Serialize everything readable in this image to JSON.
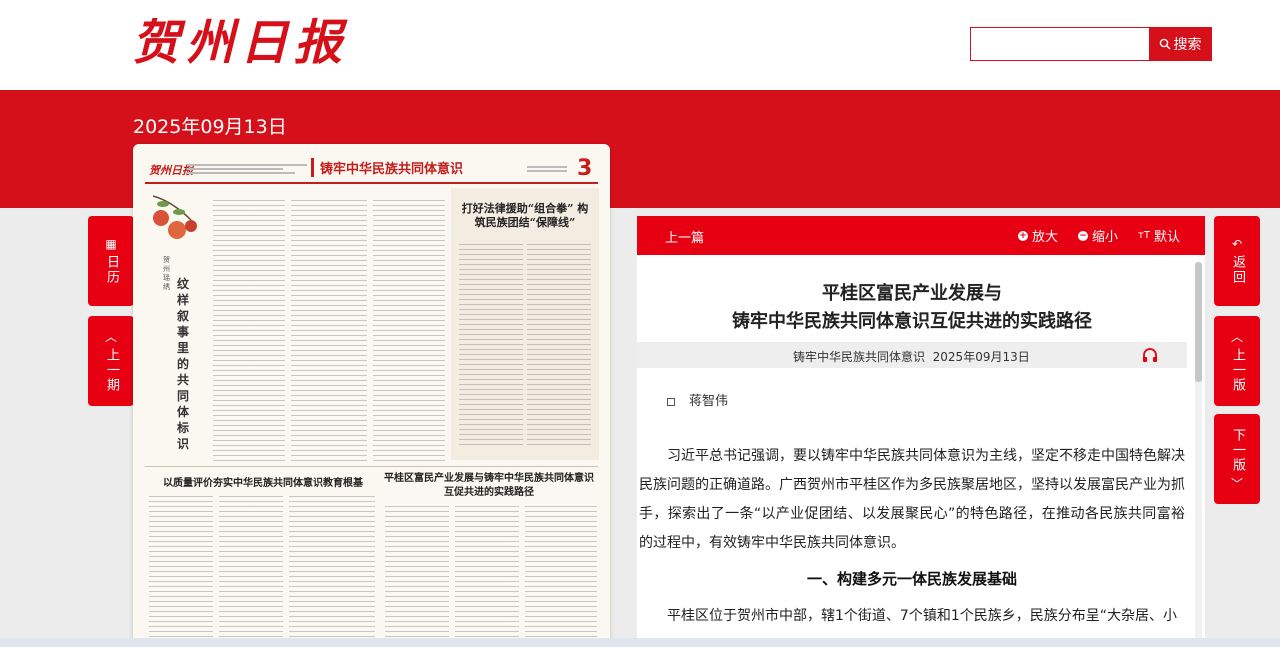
{
  "site": {
    "logo_text": "贺州日报"
  },
  "search": {
    "placeholder": "",
    "button_label": "搜索"
  },
  "issue_date": "2025年09月13日",
  "left_nav": {
    "calendar_label": "日历",
    "prev_issue_label": "上一期"
  },
  "right_nav": {
    "back_label": "返回",
    "prev_page_label": "上一版",
    "next_page_label": "下一版"
  },
  "newspaper_page": {
    "masthead": "贺州日报",
    "section_title": "铸牢中华民族共同体意识",
    "page_number": "3",
    "column_name": "贺州瑶绣",
    "feature_title": "纹样叙事里的共同体标识",
    "boxed_title": "打好法律援助“组合拳” 构筑民族团结“保障线”",
    "article_left_title": "以质量评价夯实中华民族共同体意识教育根基",
    "article_right_title": "平桂区富民产业发展与铸牢中华民族共同体意识互促共进的实践路径"
  },
  "article": {
    "toolbar": {
      "prev_label": "上一篇",
      "zoom_in_label": "放大",
      "zoom_out_label": "缩小",
      "default_label": "默认"
    },
    "title_line1": "平桂区富民产业发展与",
    "title_line2": "铸牢中华民族共同体意识互促共进的实践路径",
    "section_name": "铸牢中华民族共同体意识",
    "date": "2025年09月13日",
    "author": "蒋智伟",
    "paragraph1": "习近平总书记强调，要以铸牢中华民族共同体意识为主线，坚定不移走中国特色解决民族问题的正确道路。广西贺州市平桂区作为多民族聚居地区，坚持以发展富民产业为抓手，探索出了一条“以产业促团结、以发展聚民心”的特色路径，在推动各民族共同富裕的过程中，有效铸牢中华民族共同体意识。",
    "heading1": "一、构建多元一体民族发展基础",
    "paragraph2": "平桂区位于贺州市中部，辖1个街道、7个镇和1个民族乡，民族分布呈“大杂居、小"
  },
  "colors": {
    "brand_red": "#d6101a",
    "toolbar_red": "#e60012"
  }
}
